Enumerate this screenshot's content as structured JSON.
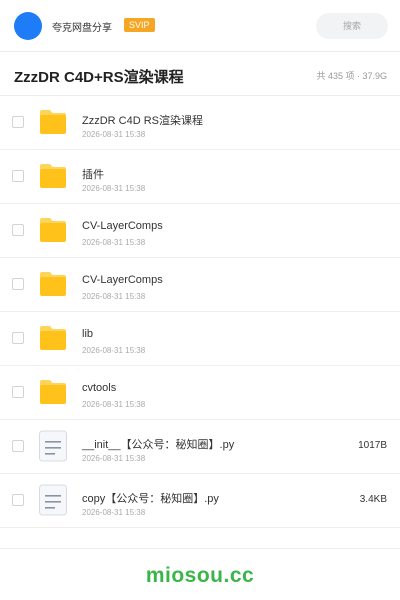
{
  "header": {
    "brand": "夸克网盘分享",
    "badge": "SVIP",
    "search_label": "搜索"
  },
  "folder": {
    "title": "ZzzDR C4D+RS渲染课程",
    "summary": "共 435 项 · 37.9G"
  },
  "files": [
    {
      "name": "ZzzDR C4D RS渲染课程",
      "date": "2026-08-31 15:38",
      "type": "folder-icon",
      "size": ""
    },
    {
      "name": "插件",
      "date": "2026-08-31 15:38",
      "type": "folder-icon",
      "size": ""
    },
    {
      "name": "CV-LayerComps",
      "date": "2026-08-31 15:38",
      "type": "folder-icon",
      "size": ""
    },
    {
      "name": "CV-LayerComps",
      "date": "2026-08-31 15:38",
      "type": "folder-icon",
      "size": ""
    },
    {
      "name": "lib",
      "date": "2026-08-31 15:38",
      "type": "folder-icon",
      "size": ""
    },
    {
      "name": "cvtools",
      "date": "2026-08-31 15:38",
      "type": "folder-icon",
      "size": ""
    },
    {
      "name": "__init__【公众号：秘知圈】.py",
      "date": "2026-08-31 15:38",
      "type": "document-icon",
      "size": "1017B"
    },
    {
      "name": "copy【公众号：秘知圈】.py",
      "date": "2026-08-31 15:38",
      "type": "document-icon",
      "size": "3.4KB"
    }
  ],
  "footer": {
    "watermark": "miosou.cc"
  },
  "colors": {
    "avatar": "#1e7cf6",
    "badge": "#f5a623",
    "folder": "#ffc21a",
    "watermark": "#3ab54a"
  }
}
